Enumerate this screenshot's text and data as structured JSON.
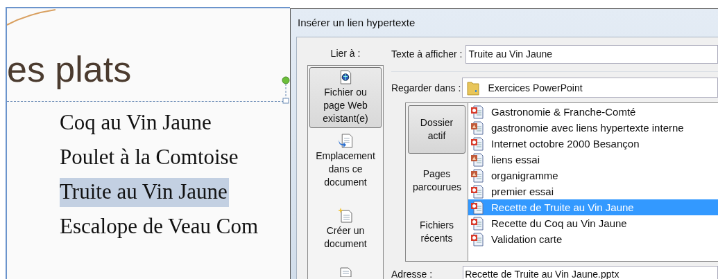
{
  "slide": {
    "title": "es plats",
    "items": [
      {
        "text": "Coq au Vin Jaune",
        "selected": false
      },
      {
        "text": "Poulet à la Comtoise",
        "selected": false
      },
      {
        "text": "Truite au Vin Jaune",
        "selected": true
      },
      {
        "text": "Escalope de Veau Com",
        "selected": false
      }
    ]
  },
  "dialog": {
    "title": "Insérer un lien hypertexte",
    "link_to_label": "Lier à :",
    "link_to": [
      {
        "kind": "file",
        "label": "Fichier ou\npage Web\nexistant(e)",
        "selected": true
      },
      {
        "kind": "place",
        "label": "Emplacement\ndans ce\ndocument",
        "selected": false
      },
      {
        "kind": "new",
        "label": "Créer un\ndocument",
        "selected": false
      },
      {
        "kind": "mail",
        "selected": false
      }
    ],
    "text_to_display": {
      "label": "Texte à afficher :",
      "value": "Truite au Vin Jaune"
    },
    "look_in": {
      "label": "Regarder dans :",
      "value": "Exercices PowerPoint"
    },
    "sources": [
      {
        "label": "Dossier\nactif",
        "selected": true
      },
      {
        "label": "Pages\nparcourues",
        "selected": false
      },
      {
        "label": "Fichiers\nrécents",
        "selected": false
      }
    ],
    "files": [
      {
        "name": "Gastronomie & Franche-Comté",
        "kind": "presentation",
        "selected": false
      },
      {
        "name": "gastronomie avec liens hypertexte interne",
        "kind": "show",
        "selected": false
      },
      {
        "name": "Internet octobre 2000  Besançon",
        "kind": "presentation",
        "selected": false
      },
      {
        "name": "liens essai",
        "kind": "show",
        "selected": false
      },
      {
        "name": "organigramme",
        "kind": "show",
        "selected": false
      },
      {
        "name": "premier essai",
        "kind": "presentation",
        "selected": false
      },
      {
        "name": "Recette de Truite au Vin Jaune",
        "kind": "presentation",
        "selected": true
      },
      {
        "name": "Recette du Coq au Vin Jaune",
        "kind": "presentation",
        "selected": false
      },
      {
        "name": "Validation carte",
        "kind": "presentation",
        "selected": false
      }
    ],
    "address": {
      "label": "Adresse :",
      "value": "Recette de Truite au Vin Jaune.pptx"
    }
  }
}
